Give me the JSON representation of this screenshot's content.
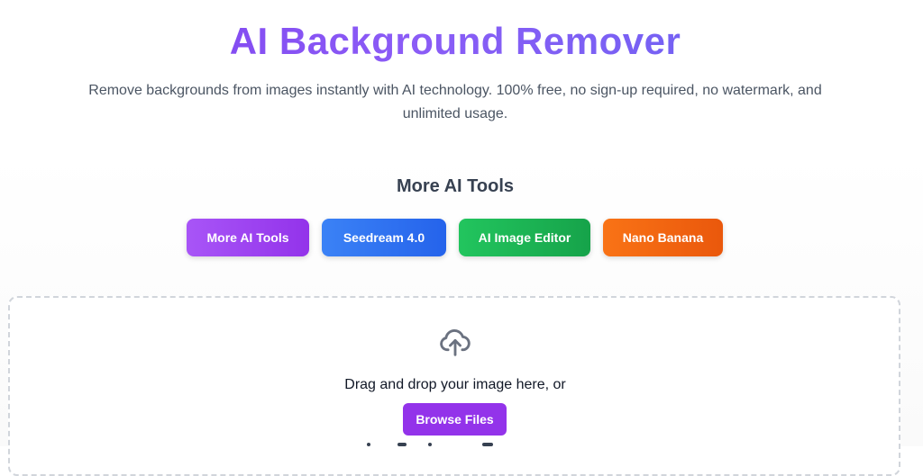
{
  "hero": {
    "title": "AI Background Remover",
    "subtitle_line1": "Remove backgrounds from images instantly with AI technology. 100% free, no sign-up required, no watermark, and",
    "subtitle_line2": "unlimited usage."
  },
  "tools": {
    "heading": "More AI Tools",
    "buttons": [
      {
        "label": "More AI Tools",
        "color": "#9333ea"
      },
      {
        "label": "Seedream 4.0",
        "color": "#2563eb"
      },
      {
        "label": "AI Image Editor",
        "color": "#16a34a"
      },
      {
        "label": "Nano Banana",
        "color": "#ea580c"
      }
    ]
  },
  "upload": {
    "icon": "cloud-upload-icon",
    "prompt": "Drag and drop your image here, or",
    "browse_label": "Browse Files"
  }
}
